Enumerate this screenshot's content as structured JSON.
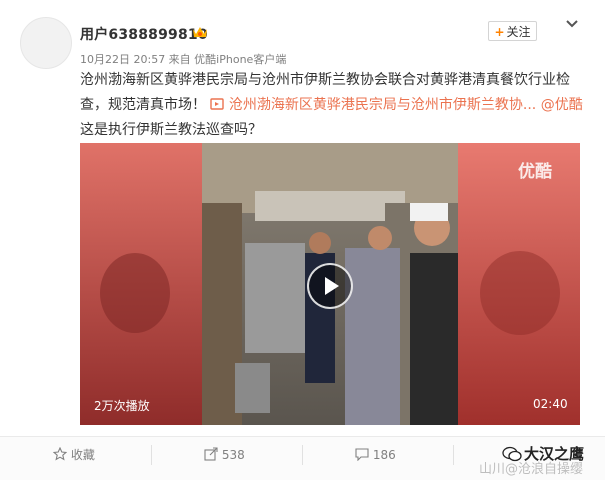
{
  "user": {
    "name": "用户6388899810",
    "meta": "10月22日 20:57 来自 优酷iPhone客户端"
  },
  "follow_label": "关注",
  "post": {
    "text_part1": "沧州渤海新区黄骅港民宗局与沧州市伊斯兰教协会联合对黄骅港清真餐饮行业检查，规范清真市场！",
    "link_text": "沧州渤海新区黄骅港民宗局与沧州市伊斯兰教协...",
    "mention": "@优酷",
    "text_part2": " 这是执行伊斯兰教法巡查吗？"
  },
  "video": {
    "logo": "优酷",
    "plays": "2万次播放",
    "duration": "02:40"
  },
  "actions": {
    "favorite": "收藏",
    "repost": "538",
    "comment": "186"
  },
  "watermark": {
    "main": "大汉之鹰",
    "sub": "山川@沧浪自操缨"
  }
}
